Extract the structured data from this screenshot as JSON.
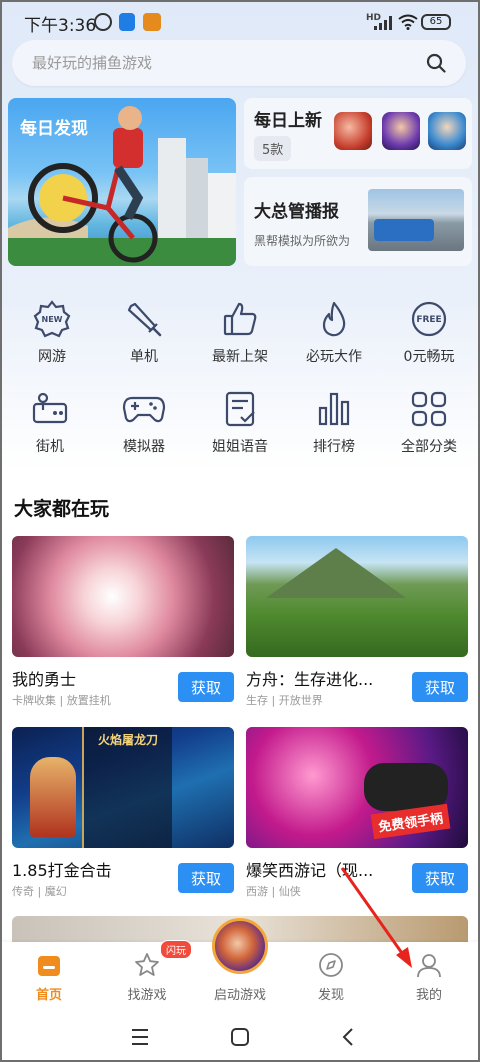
{
  "status_bar": {
    "time": "下午3:36",
    "network": "HD",
    "battery": "65"
  },
  "search": {
    "placeholder": "最好玩的捕鱼游戏"
  },
  "featured": {
    "daily": {
      "label": "每日发现"
    },
    "new_games": {
      "title": "每日上新",
      "count": "5款"
    },
    "news": {
      "title": "大总管播报",
      "subtitle": "黑帮模拟为所欲为"
    }
  },
  "categories": [
    {
      "label": "网游",
      "icon": "new-badge-icon"
    },
    {
      "label": "单机",
      "icon": "sword-icon"
    },
    {
      "label": "最新上架",
      "icon": "thumbs-up-icon"
    },
    {
      "label": "必玩大作",
      "icon": "flame-icon"
    },
    {
      "label": "0元畅玩",
      "icon": "free-badge-icon"
    },
    {
      "label": "街机",
      "icon": "arcade-joystick-icon"
    },
    {
      "label": "模拟器",
      "icon": "gamepad-icon"
    },
    {
      "label": "姐姐语音",
      "icon": "document-check-icon"
    },
    {
      "label": "排行榜",
      "icon": "bar-chart-icon"
    },
    {
      "label": "全部分类",
      "icon": "grid-icon"
    }
  ],
  "section": {
    "title": "大家都在玩"
  },
  "games": [
    {
      "name": "我的勇士",
      "tags": "卡牌收集 | 放置挂机",
      "button": "获取"
    },
    {
      "name": "方舟：生存进化...",
      "tags": "生存 | 开放世界",
      "button": "获取"
    },
    {
      "name": "1.85打金合击",
      "tags": "传奇 | 魔幻",
      "button": "获取",
      "image_text": "火焰屠龙刀"
    },
    {
      "name": "爆笑西游记（现...",
      "tags": "西游 | 仙侠",
      "button": "获取",
      "image_text": "免费领手柄"
    }
  ],
  "tabbar": {
    "items": [
      {
        "label": "首页",
        "icon": "home-icon",
        "active": true
      },
      {
        "label": "找游戏",
        "icon": "star-icon",
        "badge": "闪玩"
      },
      {
        "label": "启动游戏",
        "icon": "launch-avatar-icon"
      },
      {
        "label": "发现",
        "icon": "compass-icon"
      },
      {
        "label": "我的",
        "icon": "user-icon"
      }
    ]
  },
  "colors": {
    "accent": "#f08b1e",
    "button_blue": "#2b8ff3",
    "annotation_arrow": "#e8231e"
  }
}
